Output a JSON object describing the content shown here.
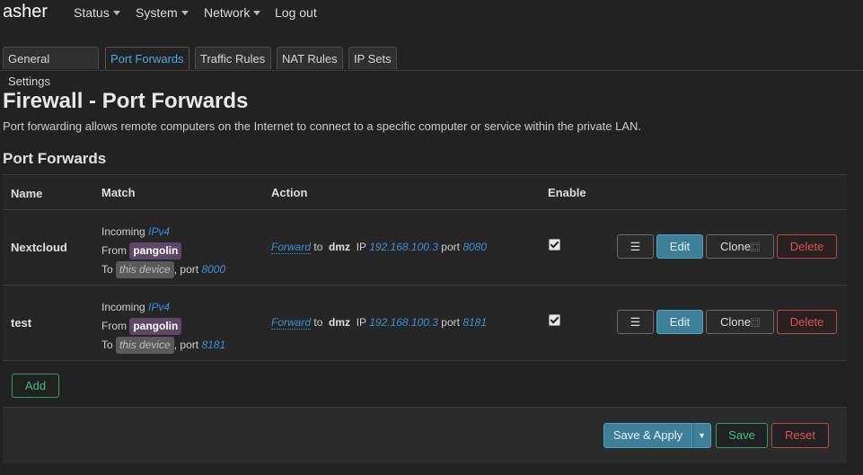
{
  "brand": "asher",
  "nav": {
    "status": "Status",
    "system": "System",
    "network": "Network",
    "logout": "Log out"
  },
  "tabs": [
    {
      "label": "General Settings",
      "active": false
    },
    {
      "label": "Port Forwards",
      "active": true
    },
    {
      "label": "Traffic Rules",
      "active": false
    },
    {
      "label": "NAT Rules",
      "active": false
    },
    {
      "label": "IP Sets",
      "active": false
    }
  ],
  "page": {
    "title": "Firewall - Port Forwards",
    "description": "Port forwarding allows remote computers on the Internet to connect to a specific computer or service within the private LAN.",
    "section_title": "Port Forwards"
  },
  "table": {
    "headers": {
      "name": "Name",
      "match": "Match",
      "action": "Action",
      "enable": "Enable"
    },
    "rows": [
      {
        "name": "Nextcloud",
        "incoming_label": "Incoming",
        "family": "IPv4",
        "from_label": "From",
        "from_zone": "pangolin",
        "to_label": "To",
        "to_target": "this device",
        "port_label": ", port",
        "match_port": "8000",
        "forward": "Forward",
        "to_word": "to",
        "dest_zone": "dmz",
        "ip_label": "IP",
        "ip": "192.168.100.3",
        "port_word": "port",
        "dest_port": "8080",
        "enabled": true
      },
      {
        "name": "test",
        "incoming_label": "Incoming",
        "family": "IPv4",
        "from_label": "From",
        "from_zone": "pangolin",
        "to_label": "To",
        "to_target": "this device",
        "port_label": ", port",
        "match_port": "8181",
        "forward": "Forward",
        "to_word": "to",
        "dest_zone": "dmz",
        "ip_label": "IP",
        "ip": "192.168.100.3",
        "port_word": "port",
        "dest_port": "8181",
        "enabled": true
      }
    ],
    "buttons": {
      "menu": "☰",
      "edit": "Edit",
      "clone": "Clone",
      "delete": "Delete"
    }
  },
  "add_label": "Add",
  "footer": {
    "save_apply": "Save & Apply",
    "dropdown": "▼",
    "save": "Save",
    "reset": "Reset"
  }
}
